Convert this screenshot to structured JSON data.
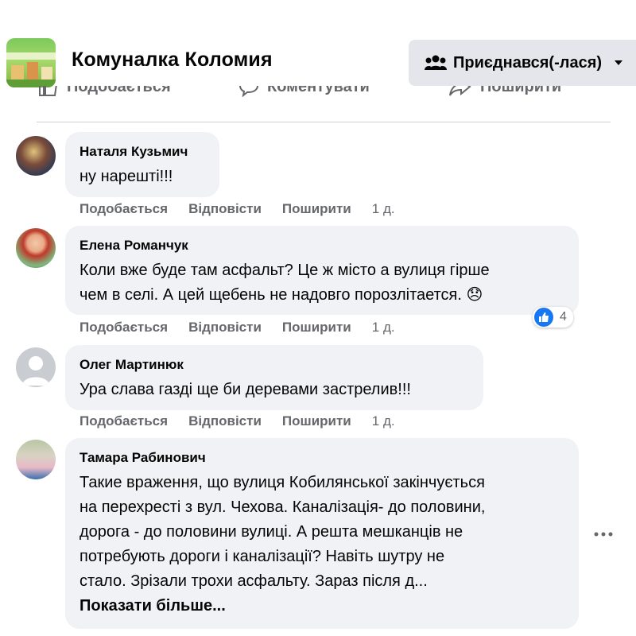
{
  "group": {
    "title": "Комуналка Коломия",
    "logo_text": "Комуналка Коломия",
    "join_label": "Приєднався(-лася)"
  },
  "post_actions": {
    "like": "Подобається",
    "comment": "Коментувати",
    "share": "Поширити"
  },
  "comments": [
    {
      "author": "Наталя Кузьмич",
      "text": "ну нарешті!!!",
      "like": "Подобається",
      "reply": "Відповісти",
      "share": "Поширити",
      "time": "1 д."
    },
    {
      "author": "Елена Романчук",
      "text_line1": "Коли вже буде там асфальт? Це ж місто а вулиця гірше",
      "text_line2": "чем в селі. А цей щебень не надовго порозлітается.",
      "emoji": "😞",
      "like": "Подобається",
      "reply": "Відповісти",
      "share": "Поширити",
      "time": "1 д.",
      "reaction_count": "4"
    },
    {
      "author": "Олег Мартинюк",
      "text": "Ура слава газді ще би деревами застрелив!!!",
      "like": "Подобається",
      "reply": "Відповісти",
      "share": "Поширити",
      "time": "1 д."
    },
    {
      "author": "Тамара Рабинович",
      "lines": [
        "Такие враження, що вулиця Кобилянської закінчується",
        "на перехресті з вул. Чехова. Каналізація- до половини,",
        "дорога - до половини вулиці. А решта мешканців не",
        "потребують дороги і каналізації? Навіть шутру не",
        "стало. Зрізали трохи асфальту. Зараз після д..."
      ],
      "show_more": "Показати більше..."
    }
  ],
  "icons": {
    "join": "group-members-icon",
    "chevron": "chevron-down-icon",
    "like": "thumbs-up-icon",
    "comment": "comment-icon",
    "share": "share-icon",
    "more": "more-horizontal-icon"
  },
  "colors": {
    "accent": "#1877f2",
    "bubble": "#f0f2f5",
    "muted": "#65676b"
  }
}
